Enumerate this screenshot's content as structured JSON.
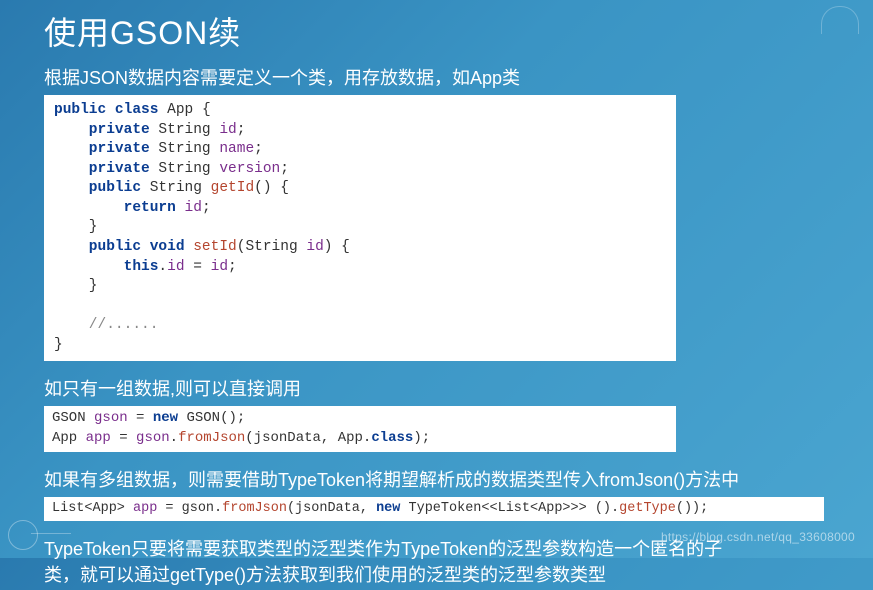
{
  "title": "使用GSON续",
  "section1_title_a": "根据",
  "section1_title_b": "JSON",
  "section1_title_c": "数据内容需要定义一个类，用存放数据，如",
  "section1_title_d": "App",
  "section1_title_e": "类",
  "code1": {
    "l1a": "public",
    "l1b": " class",
    "l1c": " App {",
    "l2a": "    private",
    "l2b": " String ",
    "l2c": "id",
    "l2d": ";",
    "l3a": "    private",
    "l3b": " String ",
    "l3c": "name",
    "l3d": ";",
    "l4a": "    private",
    "l4b": " String ",
    "l4c": "version",
    "l4d": ";",
    "l5a": "    public",
    "l5b": " String ",
    "l5c": "getId",
    "l5d": "() {",
    "l6a": "        return",
    "l6b": " id",
    "l6c": ";",
    "l7": "    }",
    "l8a": "    public",
    "l8b": " void",
    "l8c": " setId",
    "l8d": "(String ",
    "l8e": "id",
    "l8f": ") {",
    "l9a": "        this",
    "l9b": ".",
    "l9c": "id",
    "l9d": " = ",
    "l9e": "id",
    "l9f": ";",
    "l10": "    }",
    "l11": "",
    "l12": "    //......",
    "l13": "}"
  },
  "section2_title": "如只有一组数据,则可以直接调用",
  "code2": {
    "l1a": "GSON ",
    "l1b": "gson",
    "l1c": " = ",
    "l1d": "new",
    "l1e": " GSON();",
    "l2a": "App ",
    "l2b": "app",
    "l2c": " = ",
    "l2d": "gson",
    "l2e": ".",
    "l2f": "fromJson",
    "l2g": "(jsonData, App.",
    "l2h": "class",
    "l2i": ");"
  },
  "section3_title_a": "如果有多组数据，则需要借助",
  "section3_title_b": "TypeToken",
  "section3_title_c": "将期望解析成的数据类型传入",
  "section3_title_d": "fromJson()",
  "section3_title_e": "方法中",
  "code3": {
    "l1a": "List<App> ",
    "l1b": "app",
    "l1c": " = gson.",
    "l1d": "fromJson",
    "l1e": "(jsonData, ",
    "l1f": "new",
    "l1g": " TypeToken<<List<App>>> ().",
    "l1h": "getType",
    "l1i": "());"
  },
  "section4_title_a": "TypeToken",
  "section4_title_b": "只要将需要获取类型的泛型类作为",
  "section4_title_c": "TypeToken",
  "section4_title_d": "的泛型参数构造一个匿名的子",
  "section4_line2_a": "类，就可以通过",
  "section4_line2_b": "getType()",
  "section4_line2_c": "方法获取到我们使用的泛型类的泛型参数类型",
  "watermark": "https://blog.csdn.net/qq_33608000"
}
